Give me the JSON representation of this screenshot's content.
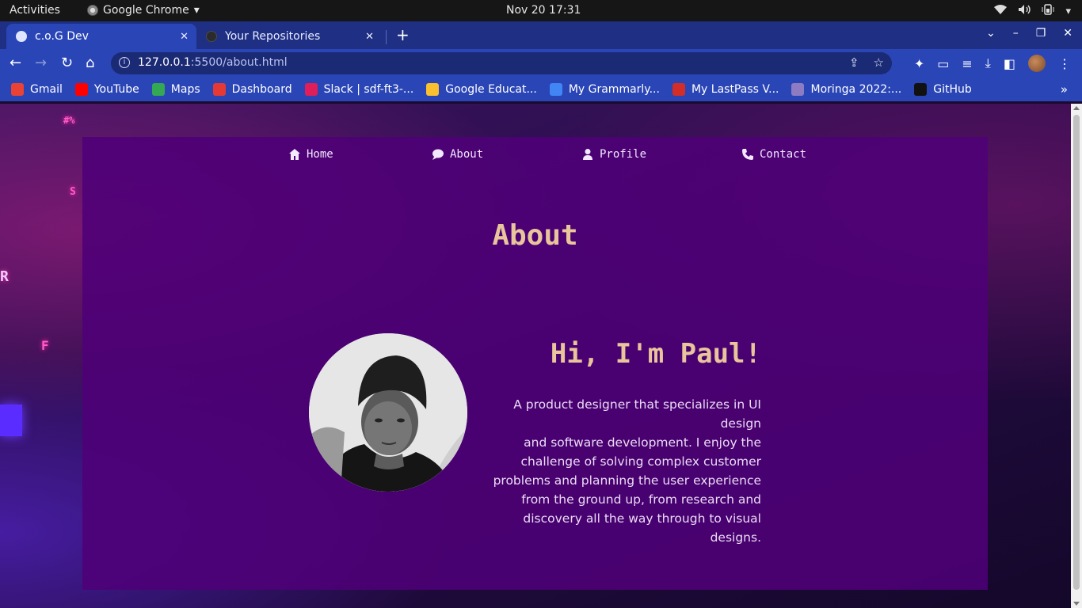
{
  "os": {
    "activities": "Activities",
    "app_name": "Google Chrome",
    "clock": "Nov 20  17:31"
  },
  "browser": {
    "tabs": [
      {
        "title": "c.o.G Dev",
        "active": true
      },
      {
        "title": "Your Repositories",
        "active": false
      }
    ],
    "url_host": "127.0.0.1",
    "url_path": ":5500/about.html",
    "bookmarks": [
      {
        "label": "Gmail",
        "icon": "gmail-icon",
        "color": "#ea4335"
      },
      {
        "label": "YouTube",
        "icon": "youtube-icon",
        "color": "#ff0000"
      },
      {
        "label": "Maps",
        "icon": "maps-icon",
        "color": "#34a853"
      },
      {
        "label": "Dashboard",
        "icon": "dashboard-icon",
        "color": "#e53935"
      },
      {
        "label": "Slack | sdf-ft3-...",
        "icon": "slack-icon",
        "color": "#e01e5a"
      },
      {
        "label": "Google Educat...",
        "icon": "google-education-icon",
        "color": "#fbc02d"
      },
      {
        "label": "My Grammarly...",
        "icon": "grammarly-icon",
        "color": "#4285f4"
      },
      {
        "label": "My LastPass V...",
        "icon": "lastpass-icon",
        "color": "#d32d27"
      },
      {
        "label": "Moringa 2022:...",
        "icon": "moringa-icon",
        "color": "#8e7cc3"
      },
      {
        "label": "GitHub",
        "icon": "github-icon",
        "color": "#111111"
      }
    ]
  },
  "page": {
    "nav": [
      {
        "label": "Home",
        "icon": "home-icon"
      },
      {
        "label": "About",
        "icon": "chat-bubble-icon"
      },
      {
        "label": "Profile",
        "icon": "user-icon"
      },
      {
        "label": "Contact",
        "icon": "phone-icon"
      }
    ],
    "title": "About",
    "greeting": "Hi, I'm Paul!",
    "bio_lines": [
      "A product designer that specializes in UI design",
      "and software development. I enjoy the",
      "challenge of solving complex customer",
      "problems and planning the user experience",
      "from the ground up, from research and",
      "discovery all the way through to visual designs."
    ],
    "colors": {
      "accent": "#e9c59c",
      "card": "#4e0078",
      "text": "#eadcf5"
    }
  }
}
